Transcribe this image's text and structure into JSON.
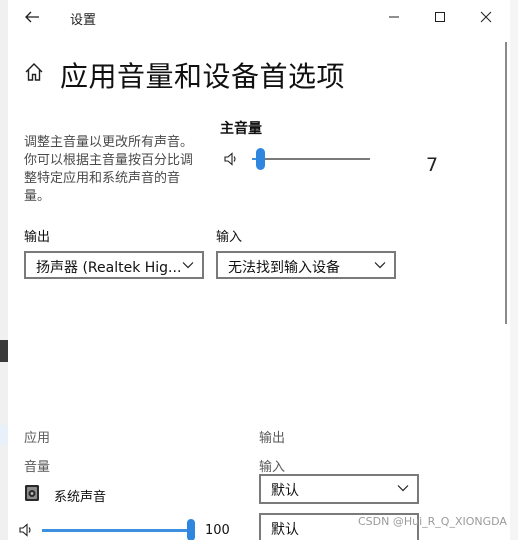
{
  "window": {
    "title": "设置"
  },
  "page": {
    "title": "应用音量和设备首选项"
  },
  "description": "调整主音量以更改所有声音。你可以根据主音量按百分比调整特定应用和系统声音的音量。",
  "master": {
    "label": "主音量",
    "value": "7",
    "level": 0.07
  },
  "output": {
    "label": "输出",
    "selected": "扬声器 (Realtek Hig..."
  },
  "input": {
    "label": "输入",
    "selected": "无法找到输入设备"
  },
  "apps": {
    "header_app": "应用",
    "header_volume": "音量",
    "header_output": "输出",
    "header_input": "输入",
    "items": [
      {
        "name": "系统声音",
        "output": "默认",
        "input": "默认",
        "volume": "100",
        "level": 1.0
      }
    ]
  },
  "watermark": "CSDN @Hui_R_Q_XIONGDA",
  "colors": {
    "accent": "#2f86de"
  }
}
